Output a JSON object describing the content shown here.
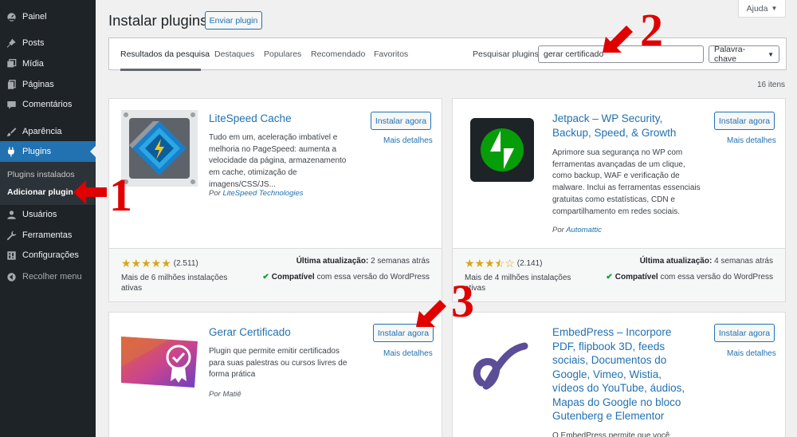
{
  "sidebar": {
    "items": [
      {
        "label": "Painel",
        "icon": "dashboard-icon"
      },
      {
        "label": "Posts",
        "icon": "pin-icon"
      },
      {
        "label": "Mídia",
        "icon": "media-icon"
      },
      {
        "label": "Páginas",
        "icon": "pages-icon"
      },
      {
        "label": "Comentários",
        "icon": "comments-icon"
      },
      {
        "label": "Aparência",
        "icon": "brush-icon"
      },
      {
        "label": "Plugins",
        "icon": "plugin-icon"
      },
      {
        "label": "Usuários",
        "icon": "users-icon"
      },
      {
        "label": "Ferramentas",
        "icon": "wrench-icon"
      },
      {
        "label": "Configurações",
        "icon": "settings-icon"
      }
    ],
    "submenu": [
      "Plugins instalados",
      "Adicionar plugin"
    ],
    "collapse_label": "Recolher menu",
    "active_color": "#2271b1"
  },
  "header": {
    "title": "Instalar plugins",
    "upload_label": "Enviar plugin",
    "help_label": "Ajuda"
  },
  "filter": {
    "tabs": [
      "Resultados da pesquisa",
      "Destaques",
      "Populares",
      "Recomendado",
      "Favoritos"
    ],
    "search_label": "Pesquisar plugins",
    "search_value": "gerar certificado",
    "search_type": "Palavra-chave"
  },
  "items_count": "16 itens",
  "plugins": [
    {
      "name_lines": [
        "LiteSpeed Cache"
      ],
      "description": "Tudo em um, aceleração imbatível e melhoria no PageSpeed: aumenta a velocidade da página, armazenamento em cache, otimização de imagens/CSS/JS...",
      "author_prefix": "Por",
      "author": "LiteSpeed Technologies",
      "install_label": "Instalar agora",
      "more_label": "Mais detalhes",
      "rating_count": "(2.511)",
      "rating": 5,
      "installs": "Mais de 6 milhões instalações ativas",
      "updated_label": "Última atualização:",
      "updated_value": "2 semanas atrás",
      "compat_label": "Compatível",
      "compat_text": "com essa versão do WordPress"
    },
    {
      "name_lines": [
        "Jetpack – WP Security,",
        "Backup, Speed, & Growth"
      ],
      "description": "Aprimore sua segurança no WP com ferramentas avançadas de um clique, como backup, WAF e verificação de malware. Inclui as ferramentas essenciais gratuitas como estatísticas, CDN e compartilhamento em redes sociais.",
      "author_prefix": "Por",
      "author": "Automattic",
      "install_label": "Instalar agora",
      "more_label": "Mais detalhes",
      "rating_count": "(2.141)",
      "rating": 3.5,
      "installs": "Mais de 4 milhões instalações ativas",
      "updated_label": "Última atualização:",
      "updated_value": "4 semanas atrás",
      "compat_label": "Compatível",
      "compat_text": "com essa versão do WordPress"
    },
    {
      "name_lines": [
        "Gerar Certificado"
      ],
      "description": "Plugin que permite emitir certificados para suas palestras ou cursos livres de forma prática",
      "author_prefix": "Por",
      "author": "Matiê",
      "install_label": "Instalar agora",
      "more_label": "Mais detalhes"
    },
    {
      "name_lines": [
        "EmbedPress – Incorpore",
        "PDF, flipbook 3D, feeds",
        "sociais, Documentos do",
        "Google, Vimeo, Wistia,",
        "vídeos do YouTube, áudios,",
        "Mapas do Google no bloco",
        "Gutenberg e Elementor"
      ],
      "description": "O EmbedPress permite que você",
      "install_label": "Instalar agora",
      "more_label": "Mais detalhes"
    }
  ],
  "annotations": [
    "1",
    "2",
    "3"
  ],
  "colors": {
    "annotation": "#e00000",
    "accent": "#2271b1",
    "star": "#dba617"
  }
}
